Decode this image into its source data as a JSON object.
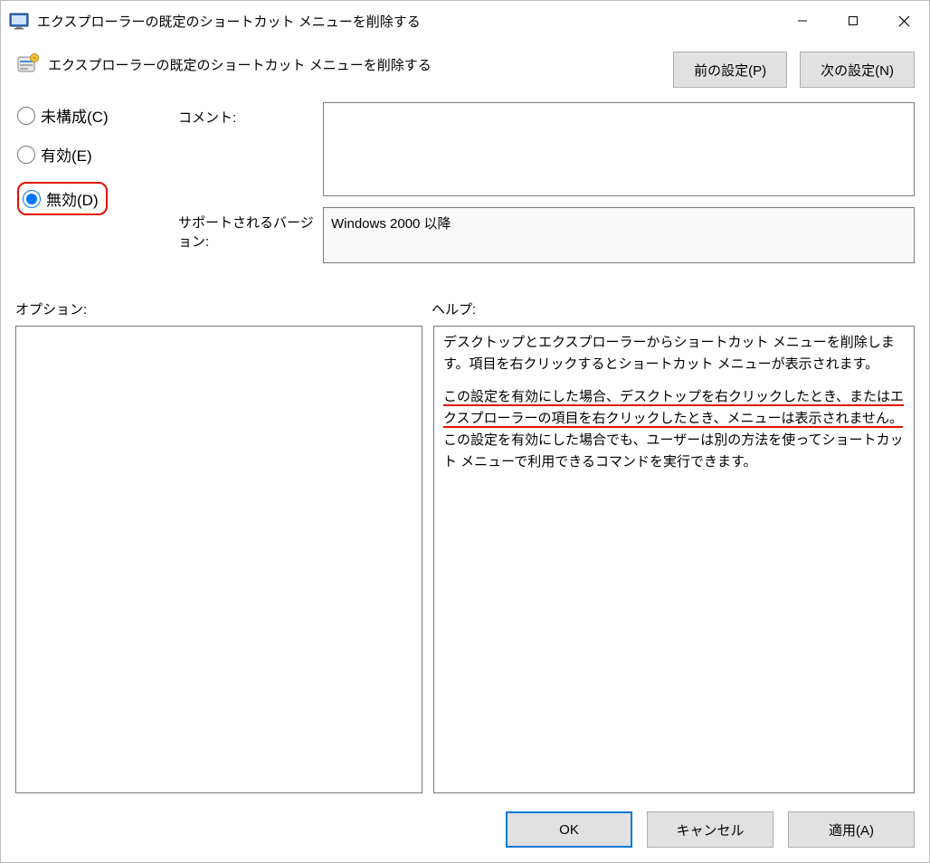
{
  "window": {
    "title": "エクスプローラーの既定のショートカット メニューを削除する"
  },
  "header": {
    "policy_title": "エクスプローラーの既定のショートカット メニューを削除する",
    "prev_button": "前の設定(P)",
    "next_button": "次の設定(N)"
  },
  "radios": {
    "not_configured": "未構成(C)",
    "enabled": "有効(E)",
    "disabled": "無効(D)",
    "selected": "disabled"
  },
  "fields": {
    "comment_label": "コメント:",
    "comment_value": "",
    "supported_label": "サポートされるバージョン:",
    "supported_value": "Windows 2000 以降"
  },
  "labels": {
    "options": "オプション:",
    "help": "ヘルプ:"
  },
  "help": {
    "p1": "デスクトップとエクスプローラーからショートカット メニューを削除します。項目を右クリックするとショートカット メニューが表示されます。",
    "p2a": "この設定を有効にした場合、デスクトップを右クリックしたとき、またはエクスプローラーの項目を右クリックしたとき、メニューは表示されません。",
    "p2b": "この設定を有効にした場合でも、ユーザーは別の方法を使ってショートカット メニューで利用できるコマンドを実行できます。"
  },
  "buttons": {
    "ok": "OK",
    "cancel": "キャンセル",
    "apply": "適用(A)"
  }
}
